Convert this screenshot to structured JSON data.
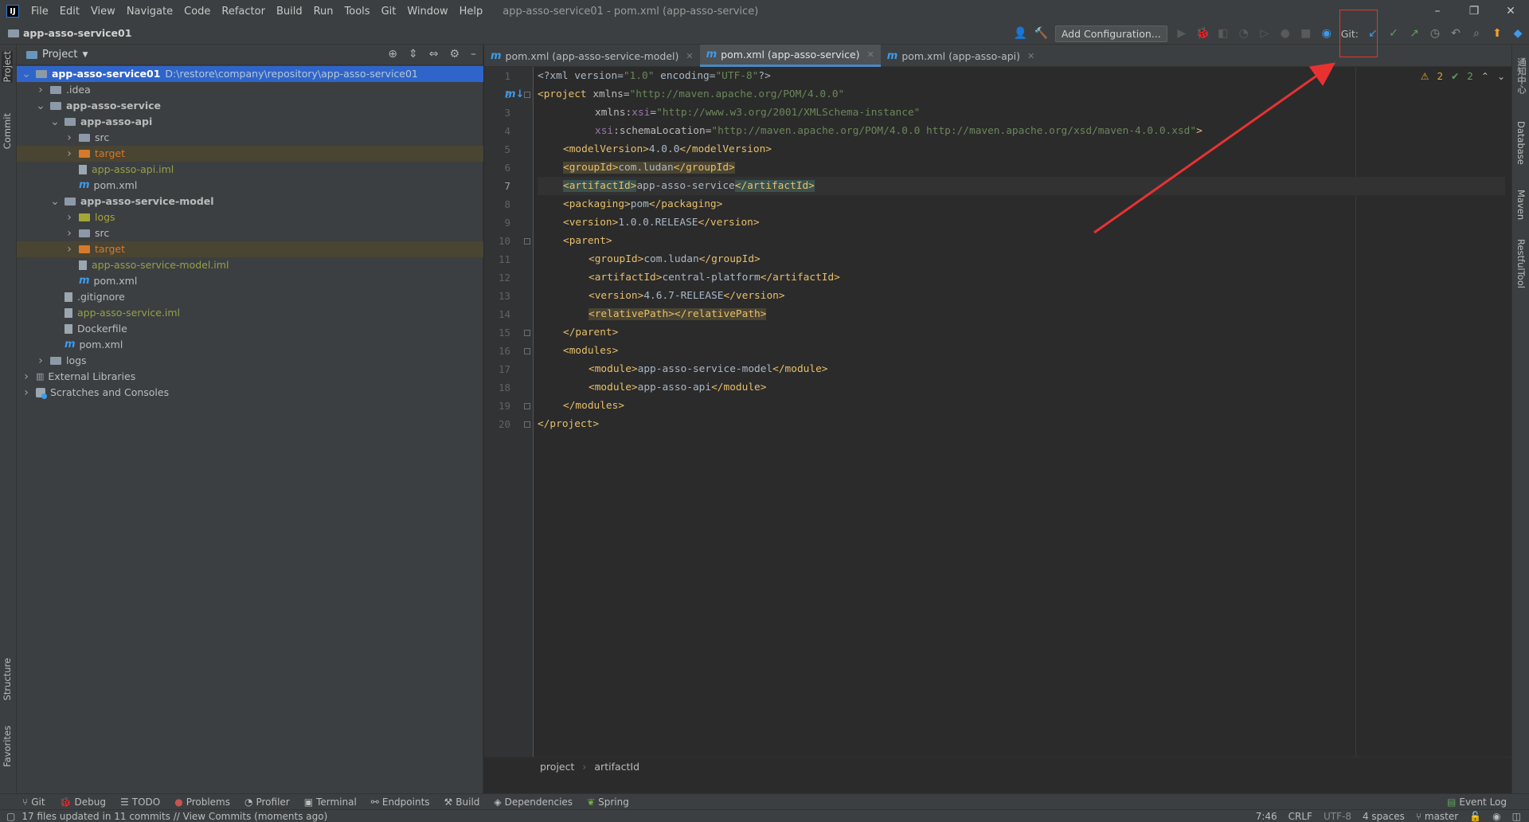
{
  "titlebar": {
    "logo": "IJ",
    "menu": [
      "File",
      "Edit",
      "View",
      "Navigate",
      "Code",
      "Refactor",
      "Build",
      "Run",
      "Tools",
      "Git",
      "Window",
      "Help"
    ],
    "window_title": "app-asso-service01 - pom.xml (app-asso-service)",
    "controls": {
      "minimize": "–",
      "restore": "❐",
      "close": "✕"
    }
  },
  "navbar": {
    "crumb": "app-asso-service01",
    "add_configuration": "Add Configuration...",
    "git_label": "Git:"
  },
  "leftstrip": {
    "project": "Project",
    "commit": "Commit",
    "structure": "Structure",
    "favorites": "Favorites"
  },
  "rightstrip": {
    "notifications": "通知中心",
    "database": "Database",
    "maven": "Maven",
    "restful": "RestfulTool"
  },
  "project_panel": {
    "title": "Project",
    "tree": [
      {
        "label": "app-asso-service01",
        "path": "D:\\restore\\company\\repository\\app-asso-service01",
        "depth": 0,
        "arrow": "v",
        "icon": "folder",
        "sel": true,
        "bold": true
      },
      {
        "label": ".idea",
        "depth": 1,
        "arrow": ">",
        "icon": "folder"
      },
      {
        "label": "app-asso-service",
        "depth": 1,
        "arrow": "v",
        "icon": "folder",
        "bold": true
      },
      {
        "label": "app-asso-api",
        "depth": 2,
        "arrow": "v",
        "icon": "folder",
        "bold": true
      },
      {
        "label": "src",
        "depth": 3,
        "arrow": ">",
        "icon": "folder"
      },
      {
        "label": "target",
        "depth": 3,
        "arrow": ">",
        "icon": "folder-orange",
        "color": "orange",
        "hl": true
      },
      {
        "label": "app-asso-api.iml",
        "depth": 3,
        "arrow": "",
        "icon": "file",
        "color": "green"
      },
      {
        "label": "pom.xml",
        "depth": 3,
        "arrow": "",
        "icon": "m"
      },
      {
        "label": "app-asso-service-model",
        "depth": 2,
        "arrow": "v",
        "icon": "folder",
        "bold": true
      },
      {
        "label": "logs",
        "depth": 3,
        "arrow": ">",
        "icon": "folder",
        "color": "yellow"
      },
      {
        "label": "src",
        "depth": 3,
        "arrow": ">",
        "icon": "folder"
      },
      {
        "label": "target",
        "depth": 3,
        "arrow": ">",
        "icon": "folder-orange",
        "color": "orange",
        "hl": true
      },
      {
        "label": "app-asso-service-model.iml",
        "depth": 3,
        "arrow": "",
        "icon": "file",
        "color": "green"
      },
      {
        "label": "pom.xml",
        "depth": 3,
        "arrow": "",
        "icon": "m"
      },
      {
        "label": ".gitignore",
        "depth": 2,
        "arrow": "",
        "icon": "file"
      },
      {
        "label": "app-asso-service.iml",
        "depth": 2,
        "arrow": "",
        "icon": "file",
        "color": "green"
      },
      {
        "label": "Dockerfile",
        "depth": 2,
        "arrow": "",
        "icon": "file"
      },
      {
        "label": "pom.xml",
        "depth": 2,
        "arrow": "",
        "icon": "m"
      },
      {
        "label": "logs",
        "depth": 1,
        "arrow": ">",
        "icon": "folder"
      },
      {
        "label": "External Libraries",
        "depth": 0,
        "arrow": ">",
        "icon": "lib"
      },
      {
        "label": "Scratches and Consoles",
        "depth": 0,
        "arrow": ">",
        "icon": "scratch"
      }
    ]
  },
  "editor": {
    "tabs": [
      {
        "label": "pom.xml (app-asso-service-model)",
        "active": false
      },
      {
        "label": "pom.xml (app-asso-service)",
        "active": true
      },
      {
        "label": "pom.xml (app-asso-api)",
        "active": false
      }
    ],
    "inspections": {
      "warnings": "2",
      "ok": "2"
    },
    "breadcrumb": [
      "project",
      "artifactId"
    ],
    "lines": [
      "1",
      "2",
      "3",
      "4",
      "5",
      "6",
      "7",
      "8",
      "9",
      "10",
      "11",
      "12",
      "13",
      "14",
      "15",
      "16",
      "17",
      "18",
      "19",
      "20"
    ],
    "code": {
      "l1": [
        "<?xml version=",
        "\"1.0\"",
        " encoding=",
        "\"UTF-8\"",
        "?>"
      ],
      "l2": [
        "<project ",
        "xmlns=",
        "\"http://maven.apache.org/POM/4.0.0\""
      ],
      "l3": [
        "xmlns:",
        "xsi",
        "=",
        "\"http://www.w3.org/2001/XMLSchema-instance\""
      ],
      "l4": [
        "xsi",
        ":schemaLocation=",
        "\"http://maven.apache.org/POM/4.0.0 http://maven.apache.org/xsd/maven-4.0.0.xsd\"",
        ">"
      ],
      "l5": [
        "<modelVersion>",
        "4.0.0",
        "</modelVersion>"
      ],
      "l6": [
        "<groupId>",
        "com.ludan",
        "</groupId>"
      ],
      "l7": [
        "<artifactId>",
        "app-asso-service",
        "</artifactId>"
      ],
      "l8": [
        "<packaging>",
        "pom",
        "</packaging>"
      ],
      "l9": [
        "<version>",
        "1.0.0.RELEASE",
        "</version>"
      ],
      "l10": [
        "<parent>"
      ],
      "l11": [
        "<groupId>",
        "com.ludan",
        "</groupId>"
      ],
      "l12": [
        "<artifactId>",
        "central-platform",
        "</artifactId>"
      ],
      "l13": [
        "<version>",
        "4.6.7-RELEASE",
        "</version>"
      ],
      "l14": [
        "<relativePath></relativePath>"
      ],
      "l15": [
        "</parent>"
      ],
      "l16": [
        "<modules>"
      ],
      "l17": [
        "<module>",
        "app-asso-service-model",
        "</module>"
      ],
      "l18": [
        "<module>",
        "app-asso-api",
        "</module>"
      ],
      "l19": [
        "</modules>"
      ],
      "l20": [
        "</project>"
      ]
    }
  },
  "bottombar": {
    "items": [
      "Git",
      "Debug",
      "TODO",
      "Problems",
      "Profiler",
      "Terminal",
      "Endpoints",
      "Build",
      "Dependencies",
      "Spring"
    ],
    "event_log": "Event Log"
  },
  "statusbar": {
    "message": "17 files updated in 11 commits // View Commits (moments ago)",
    "position": "7:46",
    "line_sep": "CRLF",
    "encoding": "UTF-8",
    "indent": "4 spaces",
    "branch": "master"
  },
  "colors": {
    "accent": "#2f65ca",
    "annotation": "#e83232"
  }
}
